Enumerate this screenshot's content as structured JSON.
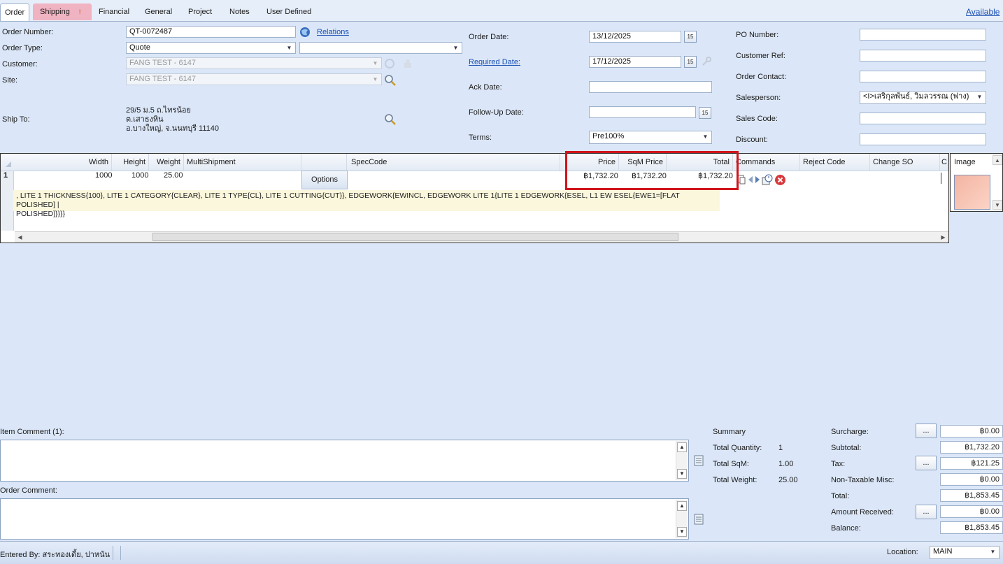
{
  "tabs": [
    "Order",
    "Shipping",
    "Financial",
    "General",
    "Project",
    "Notes",
    "User Defined"
  ],
  "shipping_warn": "!",
  "available": "Available",
  "header": {
    "order_number_label": "Order Number:",
    "order_number": "QT-0072487",
    "relations": "Relations",
    "order_type_label": "Order Type:",
    "order_type": "Quote",
    "customer_label": "Customer:",
    "customer": "FANG TEST - 6147",
    "site_label": "Site:",
    "site": "FANG TEST - 6147",
    "ship_to_label": "Ship To:",
    "ship_to_lines": [
      "29/5 ม.5 ถ.ไทรน้อย",
      "ต.เสาธงหิน",
      "อ.บางใหญ่, จ.นนทบุรี  11140"
    ],
    "order_date_label": "Order Date:",
    "order_date": "13/12/2025",
    "required_date_label": "Required Date:",
    "required_date": "17/12/2025",
    "ack_date_label": "Ack Date:",
    "followup_label": "Follow-Up Date:",
    "terms_label": "Terms:",
    "terms": "Pre100%",
    "calendar_day": "15",
    "po_label": "PO Number:",
    "custref_label": "Customer Ref:",
    "contact_label": "Order Contact:",
    "salesperson_label": "Salesperson:",
    "salesperson": "<I>เสริกุลพันธ์, วิมลวรรณ (ฟาง)",
    "salescode_label": "Sales Code:",
    "discount_label": "Discount:"
  },
  "grid": {
    "columns": [
      "Width",
      "Height",
      "Weight",
      "MultiShipment",
      "SpecCode",
      "Price",
      "SqM Price",
      "Total",
      "Commands",
      "Reject Code",
      "Change SO",
      "C"
    ],
    "row": {
      "num": "1",
      "width": "1000",
      "height": "1000",
      "weight": "25.00",
      "options": "Options",
      "price": "฿1,732.20",
      "sqm_price": "฿1,732.20",
      "total": "฿1,732.20",
      "spec_line1": ", LITE 1 THICKNESS{100}, LITE 1 CATEGORY{CLEAR}, LITE 1 TYPE{CL}, LITE 1 CUTTING{CUT}}, EDGEWORK{EWINCL, EDGEWORK LITE 1{LITE 1 EDGEWORK{ESEL, L1 EW ESEL{EWE1=[FLAT POLISHED] |",
      "spec_line2": "POLISHED]}}}}"
    },
    "image_label": "Image"
  },
  "comments": {
    "item_label": "Item Comment (1):",
    "order_label": "Order Comment:"
  },
  "summary": {
    "title": "Summary",
    "qty_label": "Total Quantity:",
    "qty": "1",
    "sqm_label": "Total SqM:",
    "sqm": "1.00",
    "weight_label": "Total Weight:",
    "weight": "25.00"
  },
  "totals": {
    "surcharge_label": "Surcharge:",
    "surcharge": "฿0.00",
    "subtotal_label": "Subtotal:",
    "subtotal": "฿1,732.20",
    "tax_label": "Tax:",
    "tax": "฿121.25",
    "nontax_label": "Non-Taxable Misc:",
    "nontax": "฿0.00",
    "total_label": "Total:",
    "total": "฿1,853.45",
    "received_label": "Amount Received:",
    "received": "฿0.00",
    "balance_label": "Balance:",
    "balance": "฿1,853.45",
    "dots": "..."
  },
  "status": {
    "entered_by": "Entered By: สระทองเดี้ย, ปาหนัน",
    "location_label": "Location:",
    "location": "MAIN"
  }
}
